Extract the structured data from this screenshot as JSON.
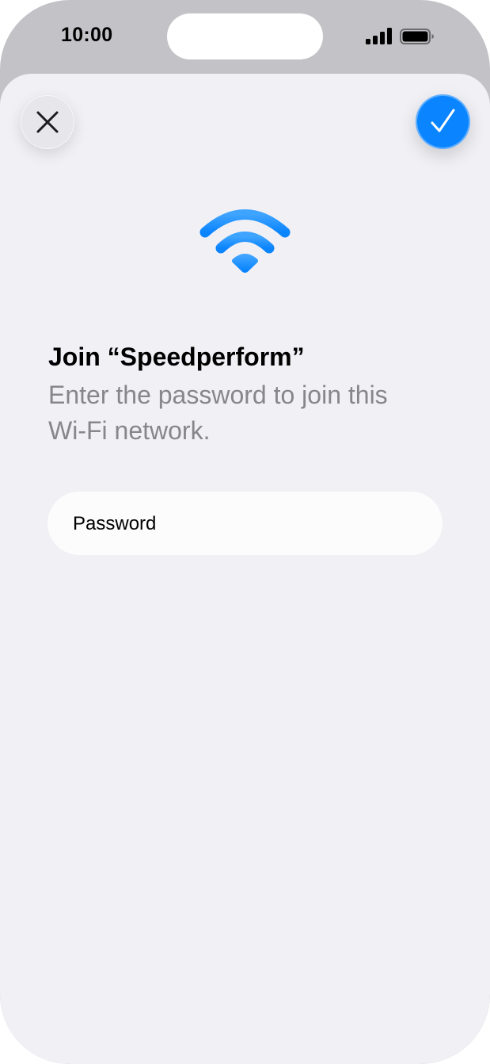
{
  "status_bar": {
    "time": "10:00",
    "signal_icon": "cellular-signal-icon",
    "battery_icon": "battery-icon"
  },
  "toolbar": {
    "close_icon": "close-icon",
    "confirm_icon": "checkmark-icon"
  },
  "wifi_icon": "wifi-icon",
  "join": {
    "title": "Join “Speedperform”",
    "subtitle": "Enter the password to join this Wi-Fi network."
  },
  "password_field": {
    "placeholder": "Password",
    "value": ""
  },
  "colors": {
    "accent": "#0a84ff",
    "sheet_background": "#f0f0f5",
    "secondary_text": "#86868b"
  }
}
